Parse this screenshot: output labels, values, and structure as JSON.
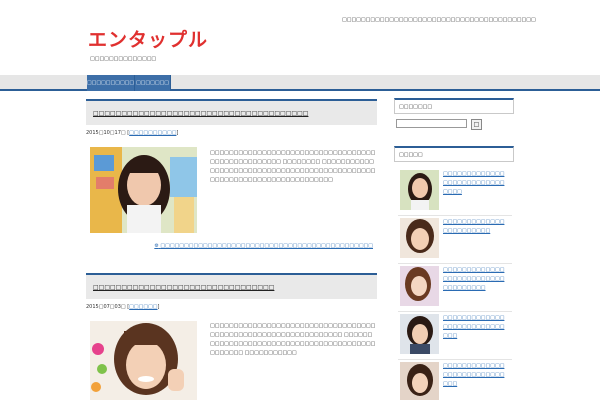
{
  "header": {
    "logo_text": "エンタップル",
    "tagline": "□□□□□□□□□□□□□□",
    "description": "□□□□□□□□□□□□□□□□□□□□□□□□□□□□□□□□□□□□□□□□□"
  },
  "nav": {
    "items": [
      {
        "label": "□□□□□□□□□□"
      },
      {
        "label": "□□□□□□□"
      }
    ]
  },
  "posts": [
    {
      "title": "□□□□□□□□□□□□□□□□□□□□□□□□□□□□□□□□□□□□□□",
      "date": "2015□10□17□",
      "category": "□□□□□□□□□□",
      "excerpt": "□□□□□□□□□□□□□□□□□□□□□□□□□□□□□□□□□□□□□□□□□□□□□□□□□□ □□□□□□□□ □□□□□□□□□□□□□□□□□□□□□□□□□□□□□□□□□□□□□□□□□□□□□□□□□□□□□□□□□□□□□□□□□□□□□□□□",
      "more": "□□□□□□□□□□□□□□□□□□□□□□□□□□□□□□□□□□□□□□□□□□□□□"
    },
    {
      "title": "□□□□□□□□□□□□□□□□□□□□□□□□□□□□□□□□",
      "date": "2015□07□03□",
      "category": "□□□□□□",
      "excerpt": "□□□□□□□□□□□□□□□□□□□□□□□□□□□□□□□□□□□□□□□□□□□□□□□□□□□□□□□□□□□□□□□ □□□□□□□□□□□□□□□□□□□□□□□□□□□□□□□□□□□□□□□□□□□□□□□□ □□□□□□□□□□□"
    }
  ],
  "sidebar": {
    "search_title": "□□□□□□□",
    "search_button": "□",
    "popular_title": "□□□□□",
    "popular": [
      {
        "title": "□□□□□□□□□□□□□□□□□□□□□□□□□□□□□□"
      },
      {
        "title": "□□□□□□□□□□□□□□□□□□□□□□□"
      },
      {
        "title": "□□□□□□□□□□□□□□□□□□□□□□□□□□□□□□□□□□□"
      },
      {
        "title": "□□□□□□□□□□□□□□□□□□□□□□□□□□□□□"
      },
      {
        "title": "□□□□□□□□□□□□□□□□□□□□□□□□□□□□□"
      }
    ]
  },
  "colors": {
    "accent": "#2c5e96",
    "logo": "#e0302f",
    "link": "#2a6bb3"
  }
}
